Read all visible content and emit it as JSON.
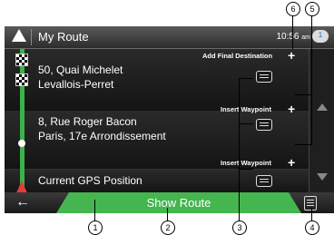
{
  "header": {
    "title": "My Route",
    "clock": "10:56",
    "clock_suffix": "am",
    "message_count": "1"
  },
  "destinations": [
    {
      "line1": "50, Quai Michelet",
      "line2": "Levallois-Perret"
    },
    {
      "line1": "8, Rue Roger Bacon",
      "line2": "Paris, 17e Arrondissement"
    }
  ],
  "current_position": "Current GPS Position",
  "actions": {
    "add_final_destination": "Add Final Destination",
    "insert_waypoint": "Insert Waypoint",
    "plus": "+"
  },
  "footer": {
    "back": "←",
    "show_route": "Show Route"
  },
  "callouts": [
    "1",
    "2",
    "3",
    "4",
    "5",
    "6"
  ],
  "icons": [
    "navigation-arrow-icon",
    "message-icon",
    "checkered-flag-icon",
    "waypoint-dot-icon",
    "gps-arrow-icon",
    "scroll-up-icon",
    "scroll-down-icon",
    "document-icon",
    "back-arrow-icon",
    "menu-icon"
  ],
  "colors": {
    "route_green": "#3bb34a",
    "button_green": "#44b54f",
    "gps_red": "#e23b3b"
  }
}
